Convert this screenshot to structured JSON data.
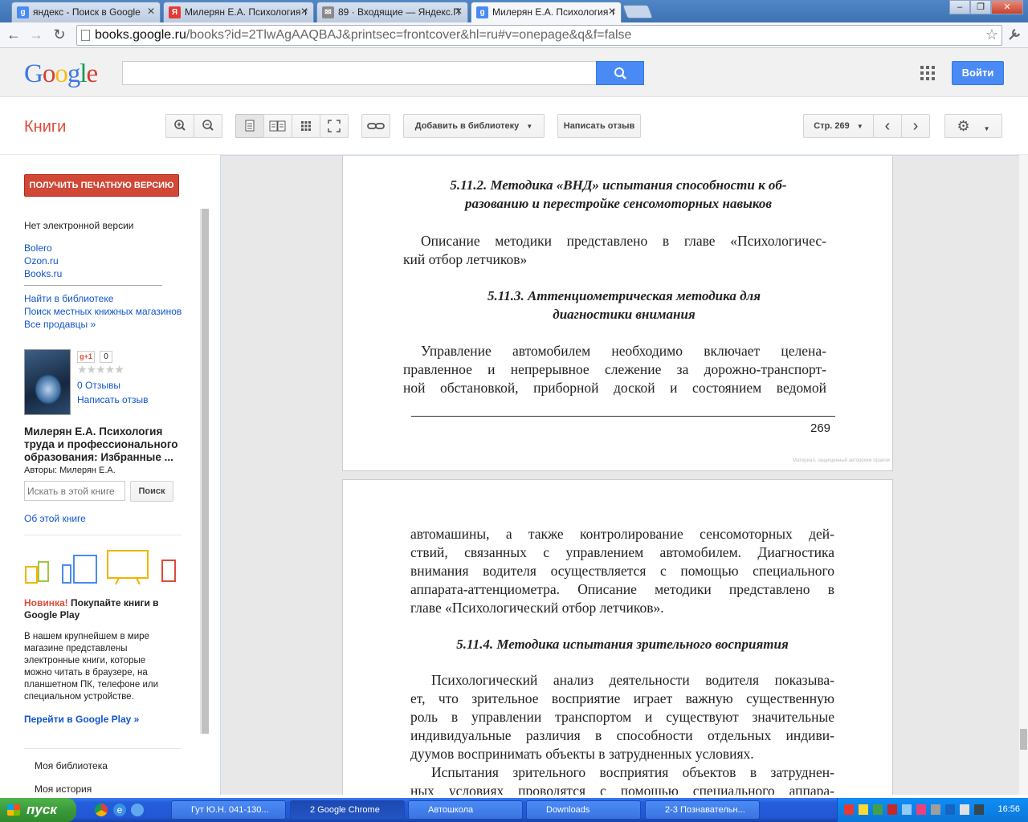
{
  "browser": {
    "tabs": [
      {
        "title": "яндекс - Поиск в Google",
        "favicon": "g",
        "favicon_color": "#4a8af4"
      },
      {
        "title": "Милерян Е.А. Психология т",
        "favicon": "Я",
        "favicon_color": "#e53935"
      },
      {
        "title": "89 · Входящие — Яндекс.П",
        "favicon": "✉",
        "favicon_color": "#8a8a8a"
      },
      {
        "title": "Милерян Е.А. Психология т",
        "favicon": "g",
        "favicon_color": "#4a8af4"
      }
    ],
    "url_host": "books.google.ru",
    "url_rest": "/books?id=2TlwAgAAQBAJ&printsec=frontcover&hl=ru#v=onepage&q&f=false",
    "window_buttons": [
      "–",
      "❐",
      "✕"
    ]
  },
  "header": {
    "logo": "Google",
    "signin_label": "Войти"
  },
  "books_bar": {
    "title": "Книги",
    "add_to_library": "Добавить в библиотеку",
    "write_review": "Написать отзыв",
    "page_label": "Стр. 269"
  },
  "sidebar": {
    "print_button": "ПОЛУЧИТЬ ПЕЧАТНУЮ ВЕРСИЮ",
    "no_ebook": "Нет электронной версии",
    "sellers": [
      "Bolero",
      "Ozon.ru",
      "Books.ru"
    ],
    "find_links": [
      "Найти в библиотеке",
      "Поиск местных книжных магазинов",
      "Все продавцы »"
    ],
    "gplus": "g+1",
    "gplus_count": "0",
    "stars": "★★★★★",
    "reviews": "0 Отзывы",
    "write_review": "Написать отзыв",
    "book_title_1": "Милерян Е.А. Психология",
    "book_title_2": "труда и профессионального",
    "book_title_3": "образования: Избранные ...",
    "authors": "Авторы: Милерян Е.А.",
    "search_placeholder": "Искать в этой книге",
    "search_button": "Поиск",
    "about": "Об этой книге",
    "promo_new": "Новинка!",
    "promo_title_1": " Покупайте книги в",
    "promo_title_2": "Google Play",
    "promo_text": [
      "В нашем крупнейшем в мире",
      "магазине представлены",
      "электронные книги, которые",
      "можно читать в браузере, на",
      "планшетном ПК, телефоне или",
      "специальном устройстве."
    ],
    "promo_link": "Перейти в Google Play »",
    "my_library": "Моя библиотека",
    "my_history": "Моя история"
  },
  "page1": {
    "heading_1": [
      "5.11.2. Методика «ВНД» испытания способности к об-",
      "разованию и перестройке сенсомоторных навыков"
    ],
    "para_1": [
      "Описание методики  представлено в главе «Психологичес-",
      "кий отбор летчиков»"
    ],
    "heading_2": [
      "5.11.3. Аттенциометрическая методика для",
      "диагностики внимания"
    ],
    "para_2": [
      "Управление автомобилем необходимо включает целена-",
      "правленное и непрерывное слежение за дорожно-транспорт-",
      "ной обстановкой, приборной доской и состоянием ведомой"
    ],
    "page_number": "269",
    "copyright": "Материал, защищенный авторским правом"
  },
  "page2": {
    "para_1": [
      "автомашины, а также контролирование сенсомоторных дей-",
      "ствий, связанных с управлением автомобилем. Диагностика",
      "внимания водителя осуществляется с помощью специального",
      "аппарата-аттенциометра. Описание методики представлено в",
      "главе «Психологический отбор летчиков»."
    ],
    "heading_1": "5.11.4. Методика испытания зрительного восприятия",
    "para_2": [
      "Психологический анализ деятельности водителя показыва-",
      "ет, что зрительное восприятие играет важную существенную",
      "роль в управлении транспортом и существуют значительные",
      "индивидуальные различия в способности отдельных индиви-",
      "дуумов воспринимать объекты в затрудненных условиях."
    ],
    "para_3": [
      "Испытания зрительного восприятия объектов в затруднен-",
      "ных условиях проводятся с помощью специального аппара-"
    ]
  },
  "taskbar": {
    "start": "пуск",
    "tasks": [
      "Гут Ю.Н. 041-130...",
      "2 Google Chrome",
      "Автошкола",
      "Downloads",
      "2-3 Познавательн..."
    ],
    "clock": "16:56"
  }
}
